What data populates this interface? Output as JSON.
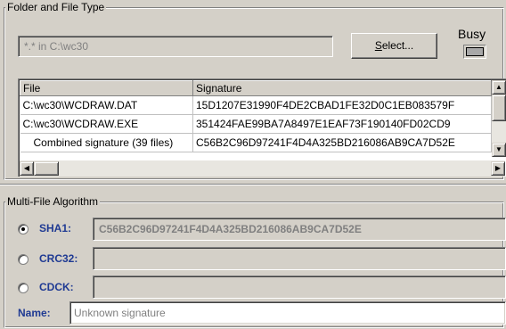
{
  "folder_group": {
    "label": "Folder and File Type",
    "path_value": "*.* in C:\\wc30",
    "select_button": {
      "mnemonic": "S",
      "rest": "elect..."
    },
    "busy_label": "Busy"
  },
  "file_table": {
    "columns": [
      "File",
      "Signature"
    ],
    "rows": [
      {
        "file": "C:\\wc30\\WCDRAW.DAT",
        "signature": "15D1207E31990F4DE2CBAD1FE32D0C1EB083579F"
      },
      {
        "file": "C:\\wc30\\WCDRAW.EXE",
        "signature": "351424FAE99BA7A8497E1EAF73F190140FD02CD9"
      },
      {
        "file": "Combined signature (39 files)",
        "signature": "C56B2C96D97241F4D4A325BD216086AB9CA7D52E"
      }
    ]
  },
  "algorithm_group": {
    "label": "Multi-File Algorithm",
    "options": [
      {
        "name": "SHA1:",
        "value": "C56B2C96D97241F4D4A325BD216086AB9CA7D52E",
        "selected": true
      },
      {
        "name": "CRC32:",
        "value": "",
        "selected": false
      },
      {
        "name": "CDCK:",
        "value": "",
        "selected": false
      }
    ],
    "name_label": "Name:",
    "name_placeholder": "Unknown signature"
  },
  "colors": {
    "face": "#d4d0c8",
    "label_blue": "#1f3a93",
    "disabled_text": "#808080"
  }
}
